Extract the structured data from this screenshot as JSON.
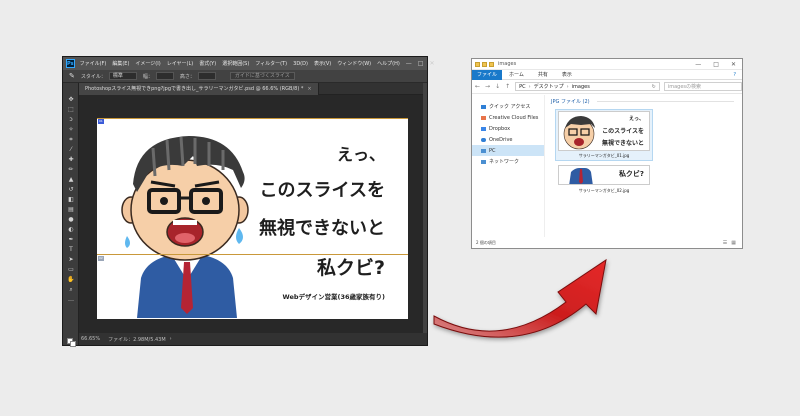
{
  "photoshop": {
    "menu": [
      "ファイル(F)",
      "編集(E)",
      "イメージ(I)",
      "レイヤー(L)",
      "書式(Y)",
      "選択範囲(S)",
      "フィルター(T)",
      "3D(D)",
      "表示(V)",
      "ウィンドウ(W)",
      "ヘルプ(H)"
    ],
    "window_controls": [
      "—",
      "□",
      "✕"
    ],
    "options": {
      "style_label": "スタイル：",
      "style_value": "標準",
      "width_label": "幅：",
      "height_label": "高さ：",
      "slice_button": "ガイドに基づくスライス"
    },
    "doc_tab": "Photoshopスライス無視できpng?jpgで書き出し_サラリーマンガタビ.psd @ 66.6% (RGB/8) *",
    "doc_tab_close": "×",
    "slice_badge_1": "01",
    "slice_badge_2": "02",
    "canvas_text": {
      "line1": "えっ、",
      "line2": "このスライスを",
      "line3": "無視できないと",
      "line4": "私クビ?",
      "tagline": "Webデザイン営業(36歳家族有り)"
    },
    "status": {
      "zoom": "66.65%",
      "file": "ファイル：2.98M/5.43M",
      "arrow": "›"
    }
  },
  "explorer": {
    "title": "images",
    "window_controls": [
      "—",
      "□",
      "✕"
    ],
    "ribbon_tabs": [
      "ファイル",
      "ホーム",
      "共有",
      "表示"
    ],
    "ribbon_help": "?",
    "nav_buttons": [
      "←",
      "→",
      "↓",
      "↑"
    ],
    "address": [
      "PC",
      "デスクトップ",
      "images"
    ],
    "address_sep": "›",
    "refresh": "↻",
    "search_placeholder": "imagesの検索",
    "sidebar": [
      {
        "label": "クイック アクセス",
        "color": "#2f7fd6"
      },
      {
        "label": "Creative Cloud Files",
        "color": "#e8744a"
      },
      {
        "label": "Dropbox",
        "color": "#3a86e8"
      },
      {
        "label": "OneDrive",
        "color": "#2f7fd6"
      },
      {
        "label": "PC",
        "color": "#4a8fd1"
      },
      {
        "label": "ネットワーク",
        "color": "#4a8fd1"
      }
    ],
    "group_header": "JPG ファイル (2)",
    "files": [
      {
        "name": "サラリーマンガタビ_01.jpg",
        "thumb_lines": [
          "えっ、",
          "このスライスを",
          "無視できないと"
        ]
      },
      {
        "name": "サラリーマンガタビ_02.jpg",
        "thumb_lines": [
          "私クビ?"
        ]
      }
    ],
    "status": "2 個の項目",
    "view_icons": [
      "☰",
      "▦"
    ]
  },
  "colors": {
    "ps_bg": "#2b2b2b",
    "slice_line": "#c9983a",
    "arrow": "#cc1e1e",
    "explorer_accent": "#1979ca"
  }
}
